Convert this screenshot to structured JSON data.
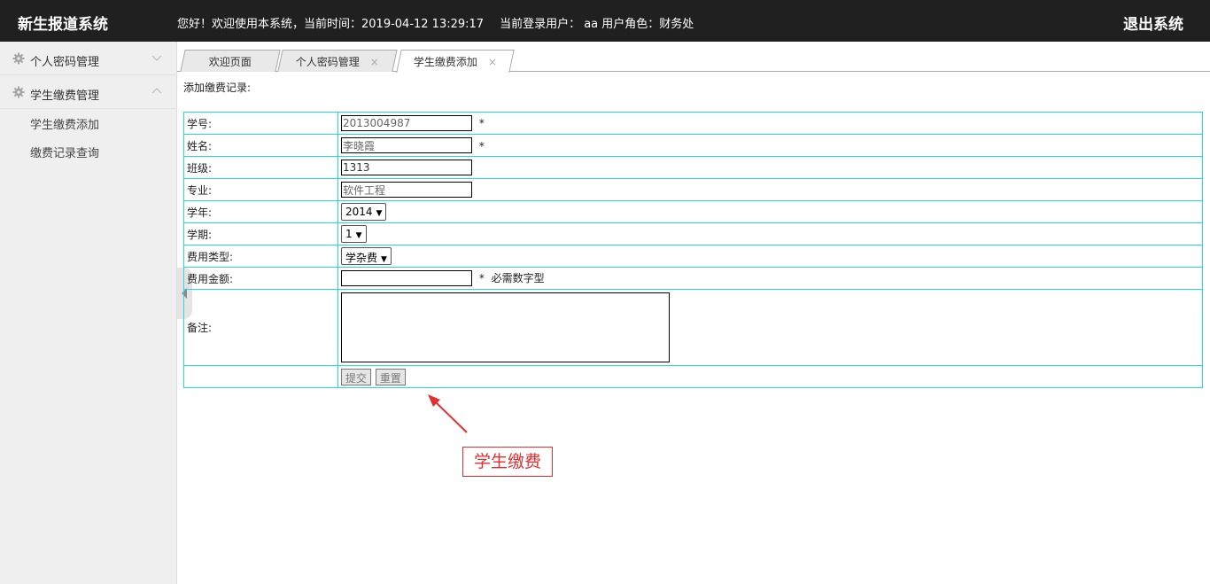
{
  "header": {
    "app_title": "新生报道系统",
    "greeting": "您好！欢迎使用本系统，当前时间：2019-04-12 13:29:17",
    "user_info": "当前登录用户：  aa  用户角色：财务处",
    "logout_label": "退出系统"
  },
  "sidebar": {
    "groups": [
      {
        "label": "个人密码管理",
        "icon": "gear-icon",
        "expanded": false
      },
      {
        "label": "学生缴费管理",
        "icon": "gear-icon",
        "expanded": true
      }
    ],
    "subitems": [
      {
        "label": "学生缴费添加"
      },
      {
        "label": "缴费记录查询"
      }
    ]
  },
  "tabs": [
    {
      "label": "欢迎页面",
      "closable": false
    },
    {
      "label": "个人密码管理",
      "closable": true
    },
    {
      "label": "学生缴费添加",
      "closable": true,
      "active": true
    }
  ],
  "tab_close_glyph": "×",
  "form": {
    "caption": "添加缴费记录:",
    "student_id": {
      "label": "学号:",
      "value": "2013004987",
      "required_mark": "*"
    },
    "name": {
      "label": "姓名:",
      "value": "李晓霞",
      "required_mark": "*"
    },
    "class": {
      "label": "班级:",
      "value": "1313"
    },
    "major": {
      "label": "专业:",
      "value": "软件工程"
    },
    "year": {
      "label": "学年:",
      "selected": "2014"
    },
    "term": {
      "label": "学期:",
      "selected": "1"
    },
    "fee_type": {
      "label": "费用类型:",
      "selected": "学杂费"
    },
    "amount": {
      "label": "费用金额:",
      "value": "",
      "required_mark": "*",
      "hint": "必需数字型"
    },
    "remark": {
      "label": "备注:",
      "value": ""
    },
    "submit_label": "提交",
    "reset_label": "重置"
  },
  "annotation": {
    "text": "学生缴费",
    "color": "#e23030"
  },
  "colors": {
    "header_bg": "#202020",
    "table_border": "#27d7e0",
    "sidebar_bg": "#efefef"
  }
}
